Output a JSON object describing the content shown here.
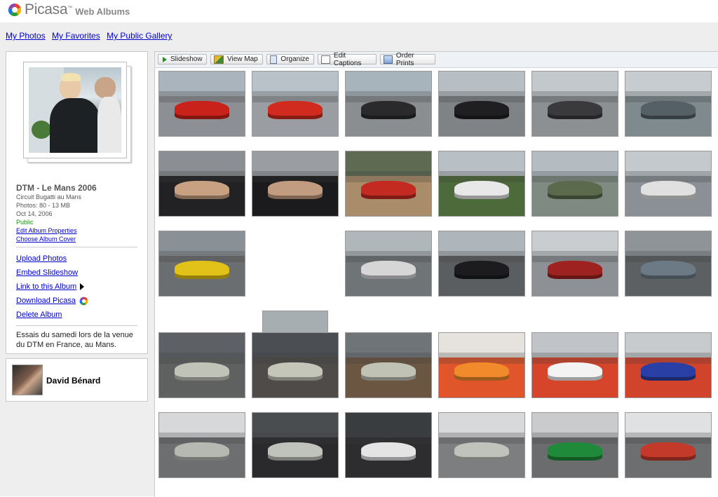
{
  "header": {
    "brand": "Picasa",
    "trademark": "™",
    "product": "Web Albums"
  },
  "nav": {
    "my_photos": "My Photos",
    "my_favorites": "My Favorites",
    "public_gallery": "My Public Gallery"
  },
  "album": {
    "title": "DTM - Le Mans 2006",
    "location": "Circuit Bugatti au Mans",
    "photos": "Photos: 80 - 13 MB",
    "date": "Oct 14, 2006",
    "visibility": "Public",
    "edit_properties": "Edit Album Properties",
    "choose_cover": "Choose Album Cover",
    "actions": {
      "upload": "Upload Photos",
      "embed": "Embed Slideshow",
      "link": "Link to this Album",
      "download": "Download Picasa",
      "delete": "Delete Album"
    },
    "description": "Essais du samedi lors de la venue du DTM en France, au Mans."
  },
  "owner": {
    "name": "David Bénard"
  },
  "toolbar": {
    "slideshow": "Slideshow",
    "view_map": "View Map",
    "organize": "Organize",
    "edit_captions": "Edit Captions",
    "order_prints": "Order Prints"
  },
  "colors": {
    "link": "#0000cc",
    "public_green": "#0a9a0a",
    "toolbar_bg": "#eef2f7",
    "nav_band": "#eeeeee"
  },
  "photos": [
    {
      "sky": "#aab4bd",
      "ground": "#8c8f93",
      "car": "#c9221b"
    },
    {
      "sky": "#b9c2c8",
      "ground": "#9a9ea2",
      "car": "#d12a1e"
    },
    {
      "sky": "#a8b4bc",
      "ground": "#8a8e91",
      "car": "#2a2a2c"
    },
    {
      "sky": "#b7bfc4",
      "ground": "#7f8386",
      "car": "#1f1f21"
    },
    {
      "sky": "#c2c8cc",
      "ground": "#8d9093",
      "car": "#3a3a3c"
    },
    {
      "sky": "#c6ccd0",
      "ground": "#7e8a8e",
      "car": "#556066"
    },
    {
      "sky": "#8b8f93",
      "ground": "#222225",
      "car": "#c8a183"
    },
    {
      "sky": "#9a9ea2",
      "ground": "#1b1b1d",
      "car": "#c29c80"
    },
    {
      "sky": "#5e6a52",
      "ground": "#a98d6a",
      "car": "#c22a22"
    },
    {
      "sky": "#b9c0c5",
      "ground": "#4d6a3a",
      "car": "#e8e8e8"
    },
    {
      "sky": "#b5bcc1",
      "ground": "#7f8b82",
      "car": "#5b6a4c"
    },
    {
      "sky": "#c3c9cd",
      "ground": "#8a9096",
      "car": "#e0e0e0"
    },
    {
      "sky": "#8a9196",
      "ground": "#6b6e70",
      "car": "#e2c218"
    },
    {
      "sky": "#a6aeb2",
      "ground": "#5c5a52",
      "car": "#c4c4c4"
    },
    {
      "sky": "#b0b7bb",
      "ground": "#6f7477",
      "car": "#d6d6d6"
    },
    {
      "sky": "#aeb6bb",
      "ground": "#5b5e60",
      "car": "#1c1c1e"
    },
    {
      "sky": "#c9cdd0",
      "ground": "#8d9195",
      "car": "#9e2320"
    },
    {
      "sky": "#8f9498",
      "ground": "#5c6062",
      "car": "#6c7a86"
    },
    {
      "sky": "#5d6166",
      "ground": "#5f6060",
      "car": "#c0c3b8"
    },
    {
      "sky": "#4b4e52",
      "ground": "#4e4b48",
      "car": "#c4c6b9"
    },
    {
      "sky": "#6f7478",
      "ground": "#6b5642",
      "car": "#c0c2b6"
    },
    {
      "sky": "#e6e3df",
      "ground": "#e0562a",
      "car": "#f08a2a"
    },
    {
      "sky": "#c0c4c8",
      "ground": "#d6442a",
      "car": "#f3f3f3"
    },
    {
      "sky": "#c7cbce",
      "ground": "#d2432b",
      "car": "#2a3fa5"
    },
    {
      "sky": "#d6d8da",
      "ground": "#6c6e70",
      "car": "#b6b8b2"
    },
    {
      "sky": "#4a4d50",
      "ground": "#2a2a2c",
      "car": "#c0c2bc"
    },
    {
      "sky": "#3a3d40",
      "ground": "#2d2d2f",
      "car": "#e4e4e4"
    },
    {
      "sky": "#d8d9db",
      "ground": "#7c7e80",
      "car": "#c0c2bc"
    },
    {
      "sky": "#c9cbcd",
      "ground": "#6a6c6e",
      "car": "#1f8a3a"
    },
    {
      "sky": "#dfe1e3",
      "ground": "#6c6e70",
      "car": "#c43a2a"
    }
  ]
}
